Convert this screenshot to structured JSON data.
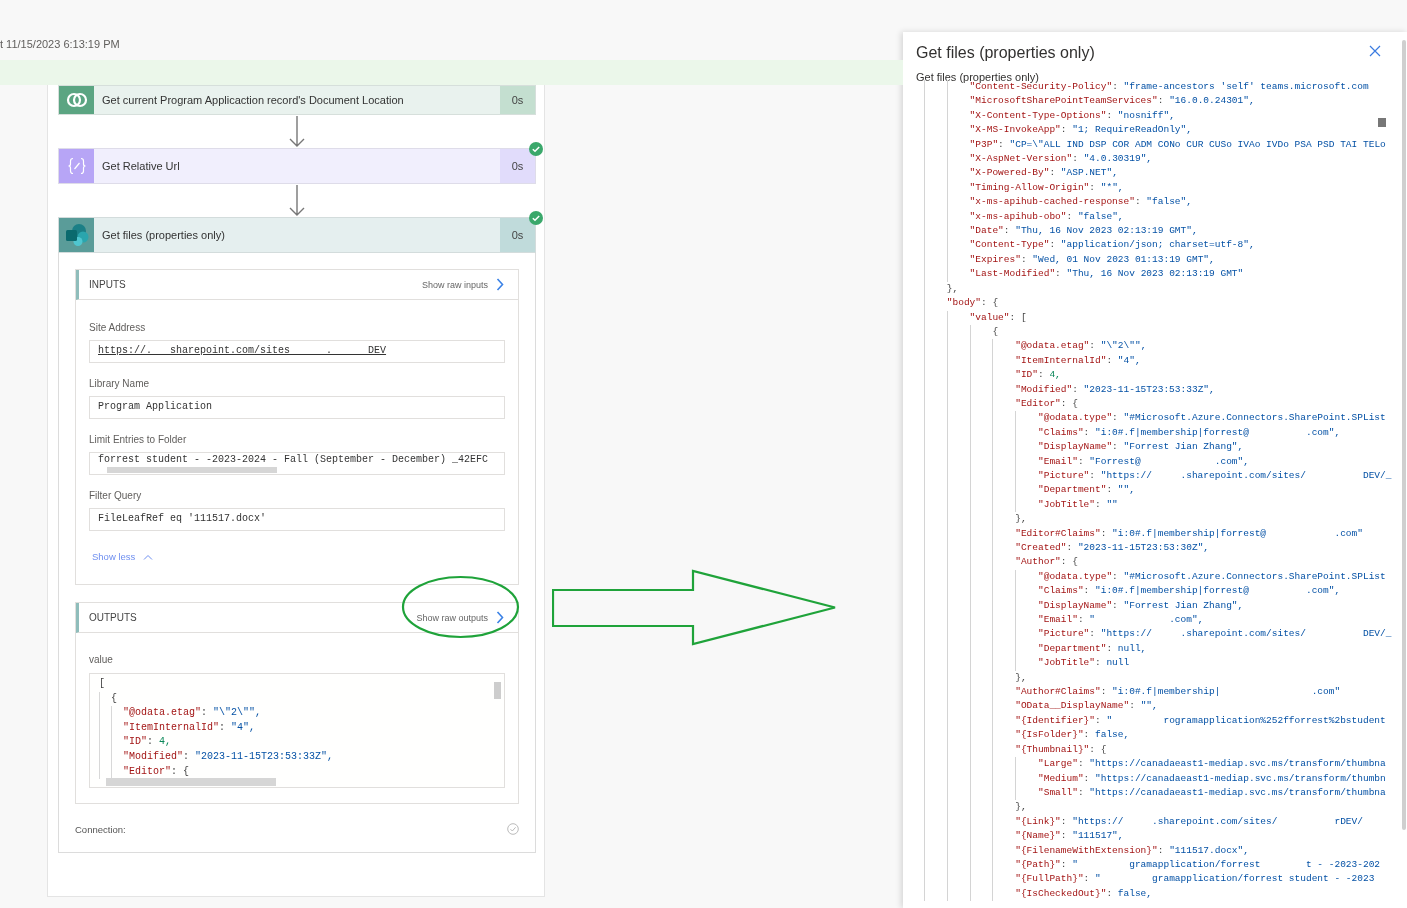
{
  "run": {
    "timestamp": "t 11/15/2023 6:13:19 PM"
  },
  "steps": [
    {
      "kind": "dataverse",
      "title": "Get current Program Applicaction record's Document Location",
      "duration": "0s",
      "succeeded": false,
      "expanded": false
    },
    {
      "kind": "variable",
      "title": "Get Relative Url",
      "duration": "0s",
      "succeeded": true,
      "expanded": false
    },
    {
      "kind": "sharepoint",
      "title": "Get files (properties only)",
      "duration": "0s",
      "succeeded": true,
      "expanded": true,
      "inputs": {
        "heading": "INPUTS",
        "raw_link": "Show raw inputs",
        "fields": [
          {
            "label": "Site Address",
            "value": "https://.   sharepoint.com/sites      .      DEV",
            "kind": "link"
          },
          {
            "label": "Library Name",
            "value": "Program Application",
            "kind": "text"
          },
          {
            "label": "Limit Entries to Folder",
            "value": "forrest student - -2023-2024 - Fall (September - December) _42EFC",
            "kind": "scroll"
          },
          {
            "label": "Filter Query",
            "value": "FileLeafRef eq '111517.docx'",
            "kind": "text"
          }
        ],
        "toggle": "Show less"
      },
      "outputs": {
        "heading": "OUTPUTS",
        "raw_link": "Show raw outputs",
        "label": "value",
        "code": [
          "[",
          "  {",
          "    \"@odata.etag\": \"\\\"2\\\"\",",
          "    \"ItemInternalId\": \"4\",",
          "    \"ID\": 4,",
          "    \"Modified\": \"2023-11-15T23:53:33Z\",",
          "    \"Editor\": {"
        ]
      },
      "connection": {
        "label": "Connection:"
      }
    }
  ],
  "panel": {
    "title": "Get files (properties only)",
    "subtitle": "Get files (properties only)",
    "code": [
      "        \"Content-Security-Policy\": \"frame-ancestors 'self' teams.microsoft.com",
      "        \"MicrosoftSharePointTeamServices\": \"16.0.0.24301\",",
      "        \"X-Content-Type-Options\": \"nosniff\",",
      "        \"X-MS-InvokeApp\": \"1; RequireReadOnly\",",
      "        \"P3P\": \"CP=\\\"ALL IND DSP COR ADM CONo CUR CUSo IVAo IVDo PSA PSD TAI TELo",
      "        \"X-AspNet-Version\": \"4.0.30319\",",
      "        \"X-Powered-By\": \"ASP.NET\",",
      "        \"Timing-Allow-Origin\": \"*\",",
      "        \"x-ms-apihub-cached-response\": \"false\",",
      "        \"x-ms-apihub-obo\": \"false\",",
      "        \"Date\": \"Thu, 16 Nov 2023 02:13:19 GMT\",",
      "        \"Content-Type\": \"application/json; charset=utf-8\",",
      "        \"Expires\": \"Wed, 01 Nov 2023 01:13:19 GMT\",",
      "        \"Last-Modified\": \"Thu, 16 Nov 2023 02:13:19 GMT\"",
      "    },",
      "    \"body\": {",
      "        \"value\": [",
      "            {",
      "                \"@odata.etag\": \"\\\"2\\\"\",",
      "                \"ItemInternalId\": \"4\",",
      "                \"ID\": 4,",
      "                \"Modified\": \"2023-11-15T23:53:33Z\",",
      "                \"Editor\": {",
      "                    \"@odata.type\": \"#Microsoft.Azure.Connectors.SharePoint.SPList",
      "                    \"Claims\": \"i:0#.f|membership|forrest@          .com\",",
      "                    \"DisplayName\": \"Forrest Jian Zhang\",",
      "                    \"Email\": \"Forrest@             .com\",",
      "                    \"Picture\": \"https://     .sharepoint.com/sites/          DEV/_",
      "                    \"Department\": \"\",",
      "                    \"JobTitle\": \"\"",
      "                },",
      "                \"Editor#Claims\": \"i:0#.f|membership|forrest@            .com\"",
      "                \"Created\": \"2023-11-15T23:53:30Z\",",
      "                \"Author\": {",
      "                    \"@odata.type\": \"#Microsoft.Azure.Connectors.SharePoint.SPList",
      "                    \"Claims\": \"i:0#.f|membership|forrest@          .com\",",
      "                    \"DisplayName\": \"Forrest Jian Zhang\",",
      "                    \"Email\": \"             .com\",",
      "                    \"Picture\": \"https://     .sharepoint.com/sites/          DEV/_",
      "                    \"Department\": null,",
      "                    \"JobTitle\": null",
      "                },",
      "                \"Author#Claims\": \"i:0#.f|membership|                .com\"",
      "                \"OData__DisplayName\": \"\",",
      "                \"{Identifier}\": \"         rogramapplication%252fforrest%2bstudent",
      "                \"{IsFolder}\": false,",
      "                \"{Thumbnail}\": {",
      "                    \"Large\": \"https://canadaeast1-mediap.svc.ms/transform/thumbna",
      "                    \"Medium\": \"https://canadaeast1-mediap.svc.ms/transform/thumbn",
      "                    \"Small\": \"https://canadaeast1-mediap.svc.ms/transform/thumbna",
      "                },",
      "                \"{Link}\": \"https://     .sharepoint.com/sites/          rDEV/",
      "                \"{Name}\": \"111517\",",
      "                \"{FilenameWithExtension}\": \"111517.docx\",",
      "                \"{Path}\": \"         gramapplication/forrest        t - -2023-202",
      "                \"{FullPath}\": \"         gramapplication/forrest student - -2023",
      "                \"{IsCheckedOut}\": false,"
    ]
  }
}
